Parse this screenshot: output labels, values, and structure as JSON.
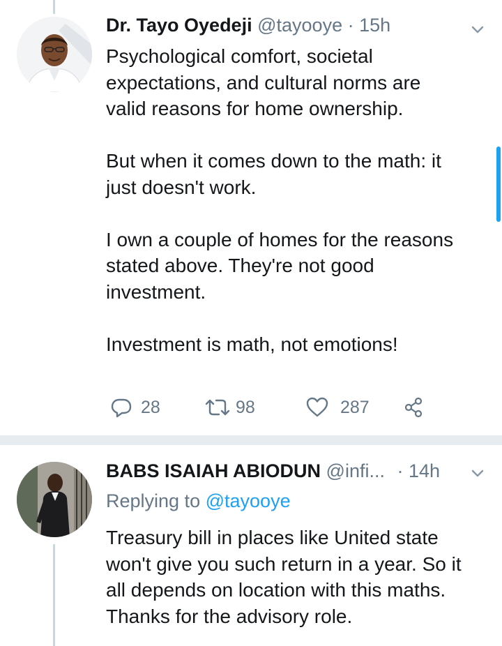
{
  "tweets": [
    {
      "author_name": "Dr. Tayo Oyedeji",
      "handle": "@tayooye",
      "separator": "·",
      "time": "15h",
      "paragraphs": [
        [
          "Psychological comfort, societal",
          "expectations, and cultural norms are",
          "valid reasons for home ownership."
        ],
        [
          "But when it comes down to the math: it",
          "just doesn't work."
        ],
        [
          "I own a couple of homes for the reasons",
          "stated above. They're not good",
          "investment."
        ],
        [
          "Investment is math, not emotions!"
        ]
      ],
      "actions": {
        "replies": "28",
        "retweets": "98",
        "likes": "287"
      }
    },
    {
      "author_name": "BABS ISAIAH ABIODUN",
      "handle": "@infi...",
      "separator": "·",
      "time": "14h",
      "replying_prefix": "Replying to",
      "replying_to": "@tayooye",
      "lines": [
        "Treasury bill in places like United state",
        "won't give you such return in a year. So it",
        "all depends on location with this maths.",
        "Thanks for the advisory role."
      ]
    }
  ],
  "icons": {
    "menu": "chevron-down-icon",
    "reply": "reply-icon",
    "retweet": "retweet-icon",
    "like": "heart-icon",
    "share": "share-icon"
  },
  "colors": {
    "text": "#14171a",
    "secondary": "#657786",
    "link": "#1da1f2",
    "divider": "#e6ecf0",
    "thread_line": "#ccd6dd"
  }
}
